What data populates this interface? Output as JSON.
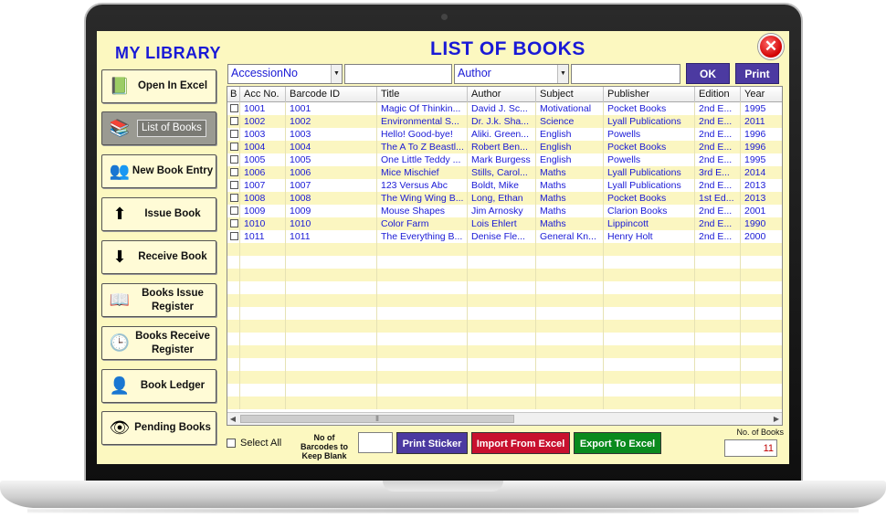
{
  "app": {
    "title": "MY LIBRARY",
    "page_title": "LIST OF BOOKS",
    "close_label": "✕"
  },
  "sidebar": {
    "items": [
      {
        "label": "Open In Excel",
        "icon": "excel-icon",
        "glyph": "📗"
      },
      {
        "label": "List of Books",
        "icon": "books-list-icon",
        "glyph": "📚",
        "active": true
      },
      {
        "label": "New Book Entry",
        "icon": "new-entry-icon",
        "glyph": "👥"
      },
      {
        "label": "Issue Book",
        "icon": "issue-arrow-icon",
        "glyph": "⬆"
      },
      {
        "label": "Receive Book",
        "icon": "receive-arrow-icon",
        "glyph": "⬇"
      },
      {
        "label": "Books Issue Register",
        "icon": "register-icon",
        "glyph": "📖"
      },
      {
        "label": "Books Receive Register",
        "icon": "clock-icon",
        "glyph": "🕒"
      },
      {
        "label": "Book Ledger",
        "icon": "ledger-icon",
        "glyph": "👤"
      },
      {
        "label": "Pending Books",
        "icon": "eye-icon",
        "glyph": "👁"
      }
    ]
  },
  "filters": {
    "field1": "AccessionNo",
    "field1_value": "",
    "field2": "Author",
    "field2_value": "",
    "ok_label": "OK",
    "print_label": "Print"
  },
  "table": {
    "columns": [
      "B",
      "Acc No.",
      "Barcode ID",
      "Title",
      "Author",
      "Subject",
      "Publisher",
      "Edition",
      "Year"
    ],
    "rows": [
      [
        "",
        "1001",
        "1001",
        "Magic Of Thinkin...",
        "David J. Sc...",
        "Motivational",
        "Pocket Books",
        "2nd E...",
        "1995"
      ],
      [
        "",
        "1002",
        "1002",
        "Environmental S...",
        "Dr. J.k. Sha...",
        "Science",
        "Lyall Publications",
        "2nd E...",
        "2011"
      ],
      [
        "",
        "1003",
        "1003",
        "Hello! Good-bye!",
        "Aliki. Green...",
        "English",
        "Powells",
        "2nd E...",
        "1996"
      ],
      [
        "",
        "1004",
        "1004",
        "The A To Z Beastl...",
        "Robert Ben...",
        "English",
        "Pocket Books",
        "2nd E...",
        "1996"
      ],
      [
        "",
        "1005",
        "1005",
        "One Little Teddy ...",
        "Mark Burgess",
        "English",
        "Powells",
        "2nd E...",
        "1995"
      ],
      [
        "",
        "1006",
        "1006",
        "Mice Mischief",
        "Stills, Carol...",
        "Maths",
        "Lyall Publications",
        "3rd E...",
        "2014"
      ],
      [
        "",
        "1007",
        "1007",
        "123 Versus Abc",
        "Boldt, Mike",
        "Maths",
        "Lyall Publications",
        "2nd E...",
        "2013"
      ],
      [
        "",
        "1008",
        "1008",
        "The Wing Wing B...",
        "Long, Ethan",
        "Maths",
        "Pocket Books",
        "1st Ed...",
        "2013"
      ],
      [
        "",
        "1009",
        "1009",
        "Mouse Shapes",
        "Jim Arnosky",
        "Maths",
        "Clarion Books",
        "2nd E...",
        "2001"
      ],
      [
        "",
        "1010",
        "1010",
        "Color Farm",
        "Lois Ehlert",
        "Maths",
        "Lippincott",
        "2nd E...",
        "1990"
      ],
      [
        "",
        "1011",
        "1011",
        "The Everything B...",
        "Denise Fle...",
        "General Kn...",
        "Henry Holt",
        "2nd E...",
        "2000"
      ]
    ],
    "scroll_grip": "⦀"
  },
  "footer": {
    "select_all_label": "Select All",
    "barcode_label": "No of Barcodes to Keep Blank",
    "barcode_value": "",
    "print_sticker_label": "Print Sticker",
    "import_label": "Import From Excel",
    "export_label": "Export To Excel",
    "count_label": "No. of Books",
    "count_value": "11"
  },
  "colors": {
    "background": "#fcf8c0",
    "title": "#1a1ad6",
    "print_sticker": "#4c3aa1",
    "import": "#c8102e",
    "export": "#0a8a1e"
  }
}
